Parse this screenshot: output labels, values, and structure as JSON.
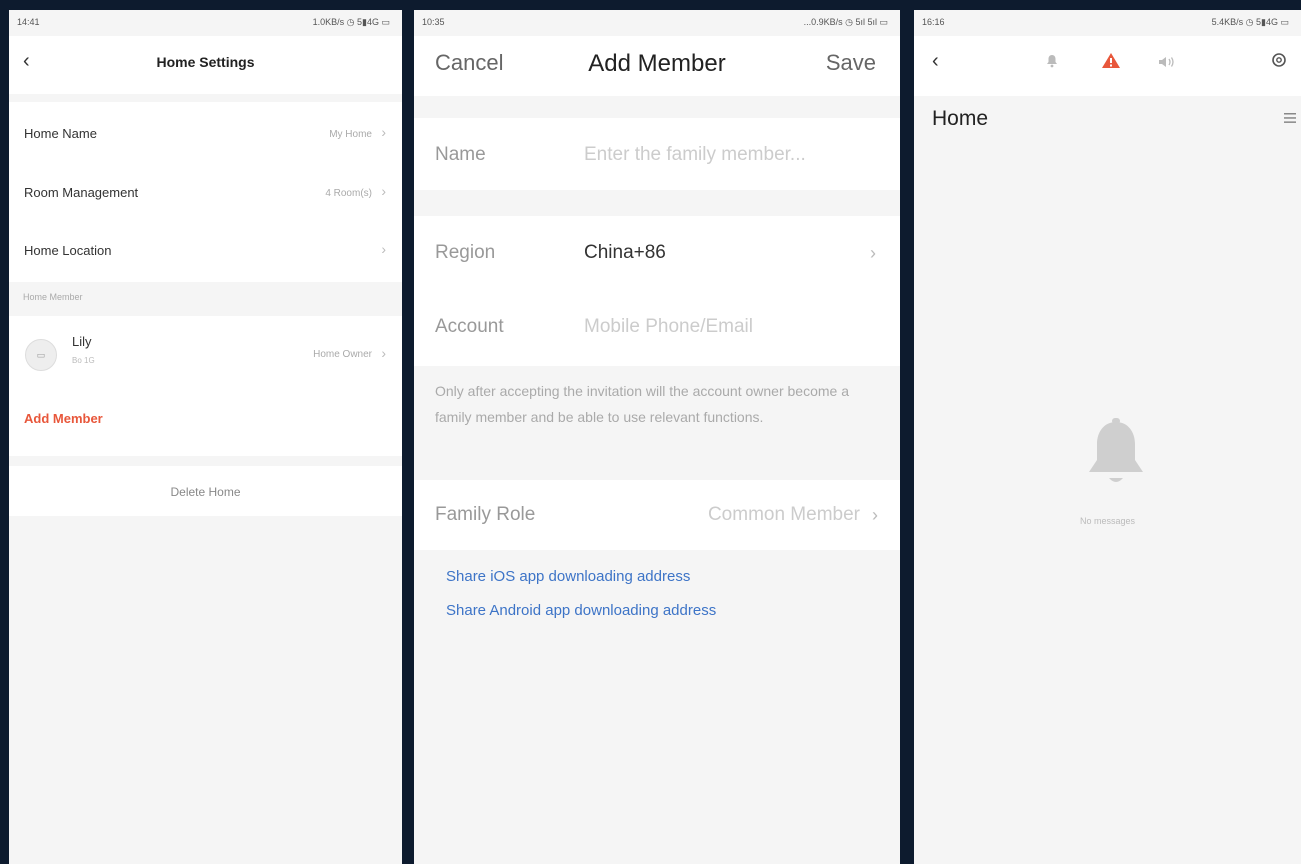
{
  "screen1": {
    "status_time": "14:41",
    "status_right": "1.0KB/s ◷ 5▮4G ▭",
    "title": "Home Settings",
    "rows": [
      {
        "label": "Home Name",
        "value": "My Home"
      },
      {
        "label": "Room Management",
        "value": "4 Room(s)"
      },
      {
        "label": "Home Location",
        "value": ""
      }
    ],
    "member_section": "Home Member",
    "member": {
      "name": "Lily",
      "sub": "Bo 1G",
      "role": "Home Owner"
    },
    "add_member": "Add Member",
    "delete_home": "Delete Home"
  },
  "screen2": {
    "status_time": "10:35",
    "status_right": "...0.9KB/s ◷ 5ıl 5ıl ▭",
    "cancel": "Cancel",
    "title": "Add Member",
    "save": "Save",
    "name_label": "Name",
    "name_placeholder": "Enter the family member...",
    "region_label": "Region",
    "region_value": "China+86",
    "account_label": "Account",
    "account_placeholder": "Mobile Phone/Email",
    "note": "Only after accepting the invitation will the account owner become a family member and be able to use relevant functions.",
    "role_label": "Family Role",
    "role_value": "Common Member",
    "link_ios": "Share iOS app downloading address",
    "link_android": "Share Android app downloading address"
  },
  "screen3": {
    "status_time": "16:16",
    "status_right": "5.4KB/s ◷ 5▮4G ▭",
    "title": "Home",
    "empty_text": "No messages"
  },
  "colors": {
    "accent": "#e8573b",
    "link": "#3d74c7",
    "frame": "#0d1b2e"
  }
}
